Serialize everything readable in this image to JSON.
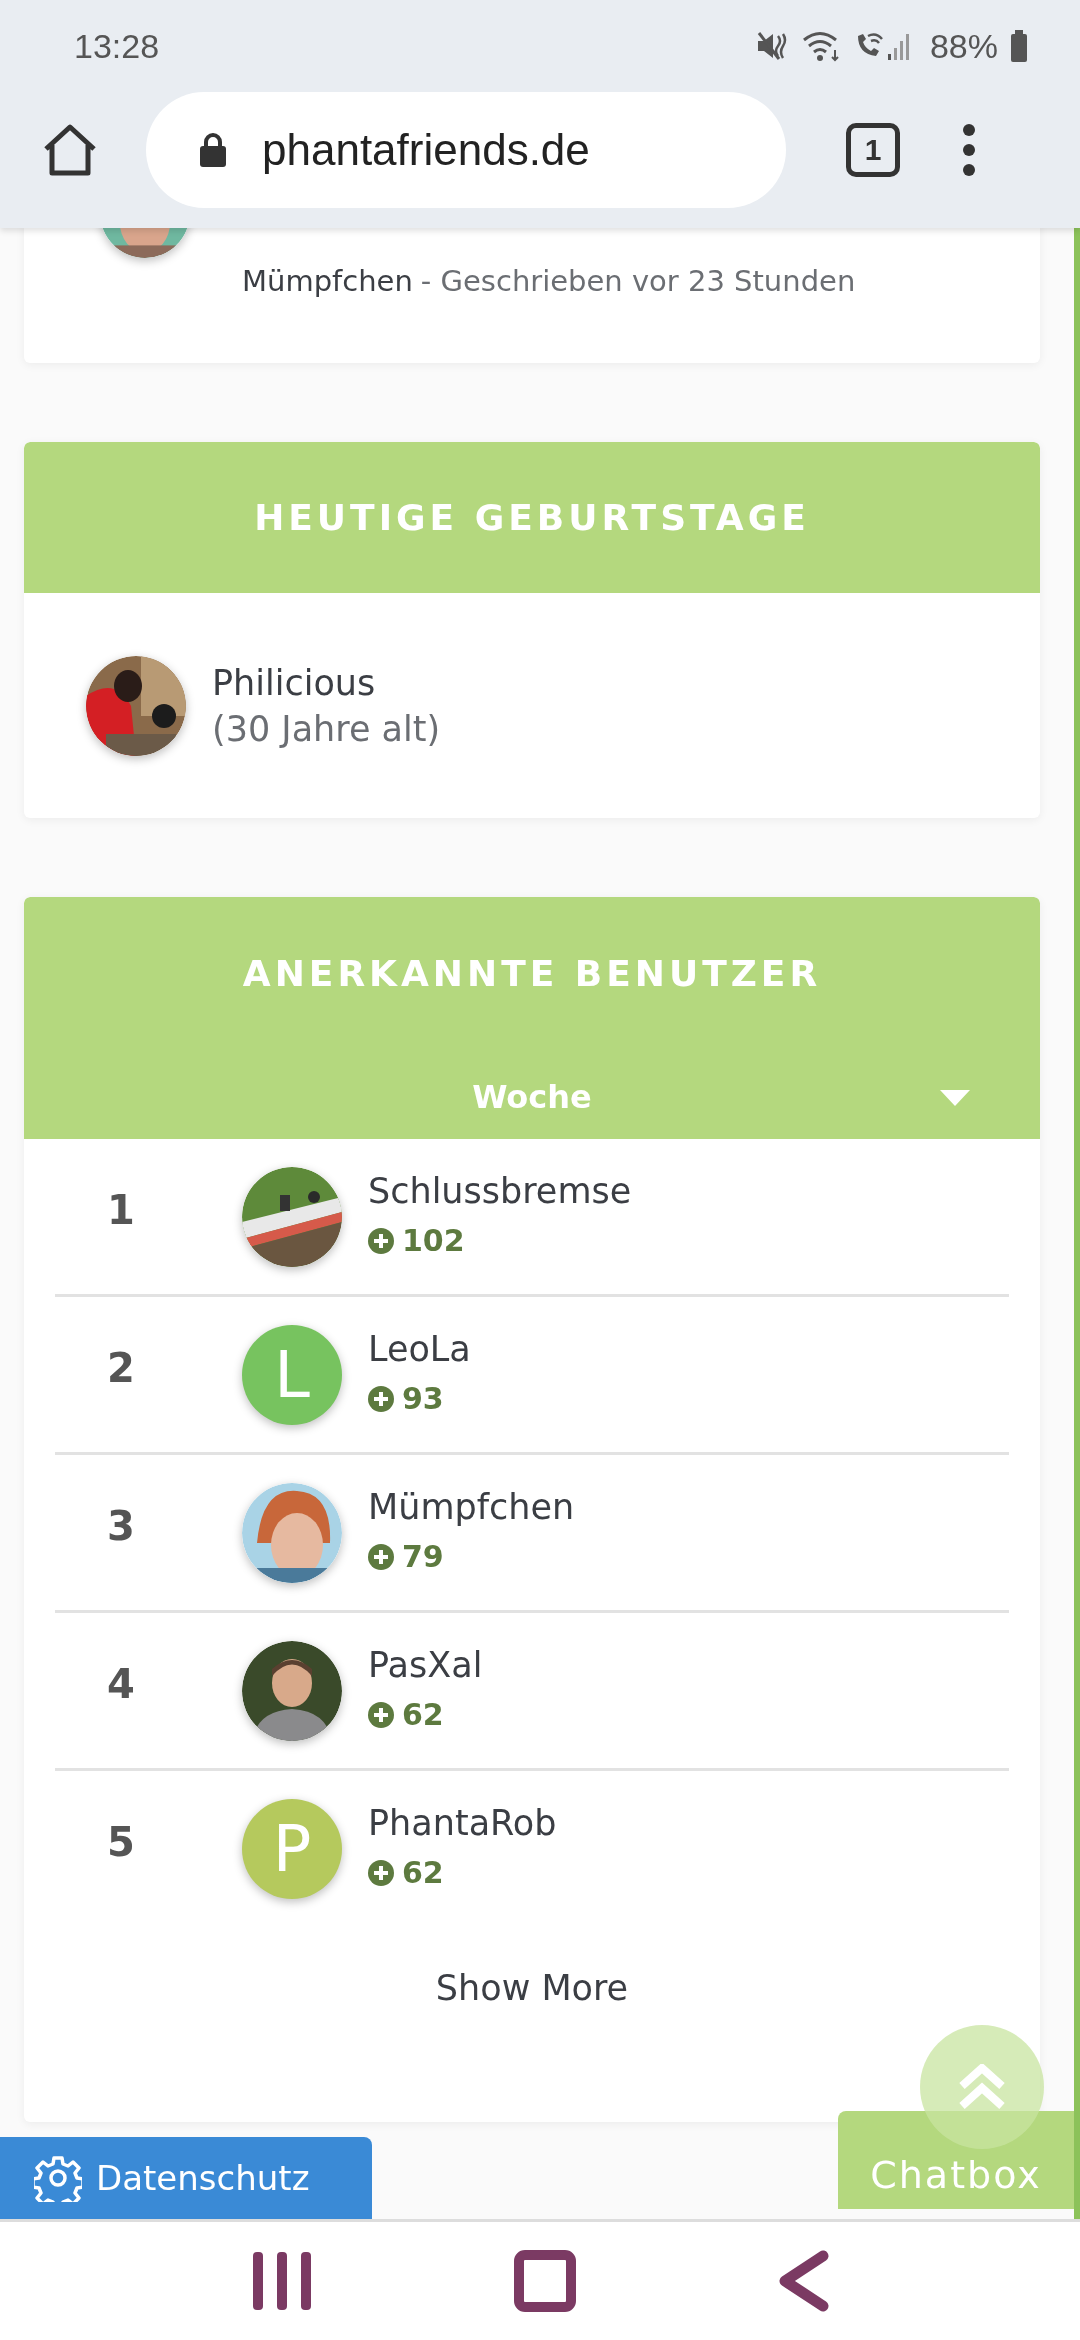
{
  "status_bar": {
    "time": "13:28",
    "battery": "88%"
  },
  "browser": {
    "url": "phantafriends.de",
    "tab_count": "1"
  },
  "recent_post": {
    "author": "Mümpfchen",
    "meta": "- Geschrieben vor 23 Stunden"
  },
  "birthdays": {
    "title": "HEUTIGE GEBURTSTAGE",
    "people": [
      {
        "name": "Philicious",
        "age": "(30 Jahre alt)"
      }
    ]
  },
  "top_users": {
    "title": "ANERKANNTE BENUTZER",
    "period": "Woche",
    "users": [
      {
        "rank": "1",
        "name": "Schlussbremse",
        "score": "102"
      },
      {
        "rank": "2",
        "name": "LeoLa",
        "score": "93",
        "avatar": {
          "kind": "letter",
          "letter": "L",
          "color": "#77c35f"
        }
      },
      {
        "rank": "3",
        "name": "Mümpfchen",
        "score": "79"
      },
      {
        "rank": "4",
        "name": "PasXal",
        "score": "62"
      },
      {
        "rank": "5",
        "name": "PhantaRob",
        "score": "62",
        "avatar": {
          "kind": "letter",
          "letter": "P",
          "color": "#b5c95d"
        }
      }
    ],
    "show_more": "Show More"
  },
  "privacy_button": "Datenschutz",
  "chatbox": "Chatbox"
}
